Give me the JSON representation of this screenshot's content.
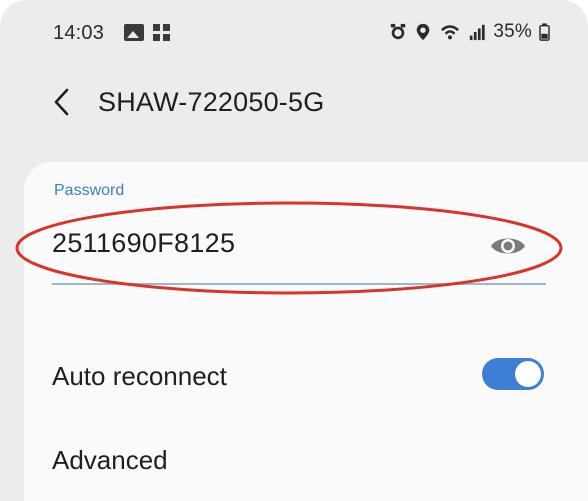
{
  "status_bar": {
    "time": "14:03",
    "battery": "35%",
    "left_icons": [
      "gallery-icon",
      "grid-icon"
    ],
    "right_icons": [
      "alarm-icon",
      "location-icon",
      "wifi-icon",
      "signal-icon",
      "battery-icon"
    ]
  },
  "app_bar": {
    "title": "SHAW-722050-5G",
    "back_icon": "back-arrow-icon"
  },
  "password": {
    "label": "Password",
    "value": "2511690F8125",
    "toggle_icon": "eye-icon"
  },
  "settings": {
    "auto_reconnect": {
      "label": "Auto reconnect",
      "enabled": true
    },
    "advanced": {
      "label": "Advanced"
    }
  },
  "colors": {
    "accent": "#3d7fd6",
    "label_blue": "#3b7fc4",
    "highlight_red": "#d9342b",
    "background": "#ececec",
    "card": "#fafafa"
  }
}
